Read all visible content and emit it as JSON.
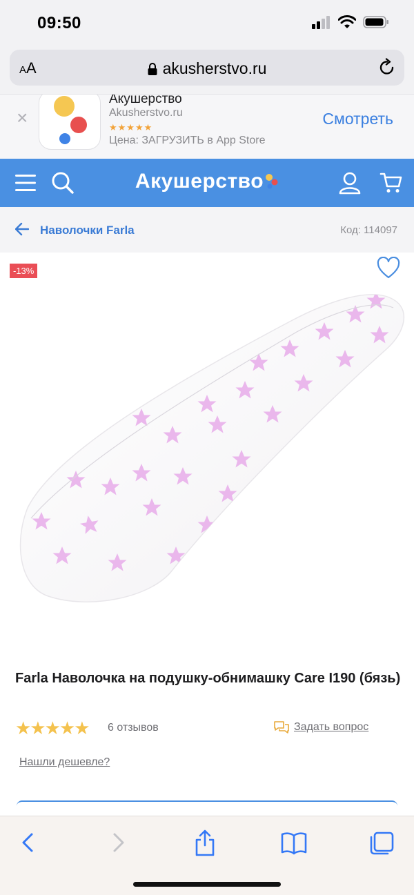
{
  "status_bar": {
    "time": "09:50"
  },
  "browser": {
    "aa_small": "A",
    "aa_large": "A",
    "url": "akusherstvo.ru"
  },
  "app_banner": {
    "app_name": "Акушерство",
    "site": "Akusherstvo.ru",
    "stars": "★★★★★",
    "price": "Цена: ЗАГРУЗИТЬ в App Store",
    "view_button": "Смотреть",
    "close": "×"
  },
  "header": {
    "logo": "Акушерство",
    "brand_colors": {
      "header_bg": "#4a90e2",
      "dot_yellow": "#f5c752",
      "dot_red": "#e8504f",
      "dot_blue": "#3f83e6"
    }
  },
  "breadcrumb": {
    "label": "Наволочки Farla",
    "code": "Код: 114097"
  },
  "product": {
    "discount": "-13%",
    "title": "Farla Наволочка на подушку-обнимашку Care I190 (бязь)",
    "rating": 4.5,
    "stars": "★★★★★",
    "reviews": "6 отзывов",
    "ask_question": "Задать вопрос",
    "found_cheaper": "Нашли дешевле?"
  },
  "toolbar": {
    "items": [
      "back-icon",
      "forward-icon",
      "share-icon",
      "bookmarks-icon",
      "tabs-icon"
    ]
  }
}
